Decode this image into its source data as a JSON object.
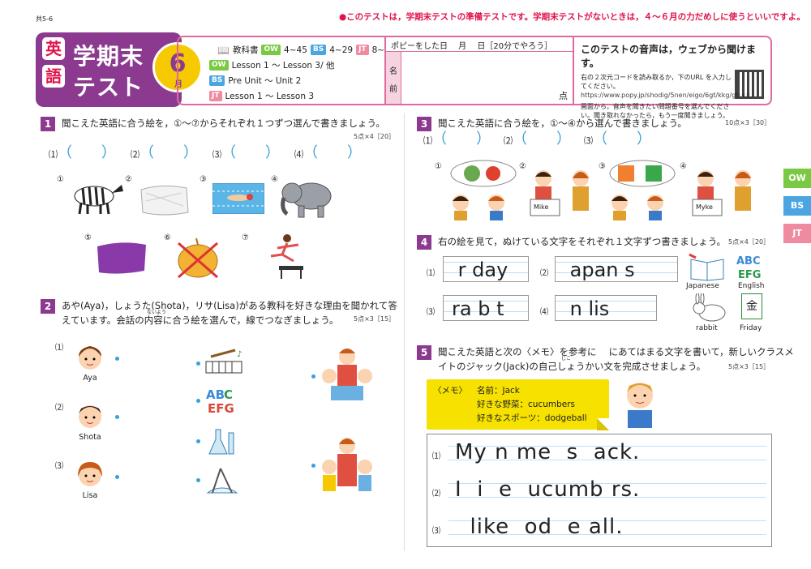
{
  "meta": {
    "code": "共5-6"
  },
  "notice": "●このテストは，学期末テストの準備テストです。学期末テストがないときは，４～６月の力だめしに使うといいですよ。",
  "header": {
    "subject_1": "英",
    "subject_2": "語",
    "title_1": "学期末",
    "title_2": "テスト",
    "month_num": "6",
    "month_label": "月",
    "textbook_label": "教科書",
    "ow_tag": "OW",
    "ow_pages": "4~45",
    "bs_tag": "BS",
    "bs_pages": "4~29",
    "jt_tag": "JT",
    "jt_pages": "8~54",
    "rows": [
      {
        "tag": "OW",
        "text": "Lesson 1 ～ Lesson 3/ 他"
      },
      {
        "tag": "BS",
        "text": "Pre Unit ～ Unit 2"
      },
      {
        "tag": "JT",
        "text": "Lesson 1 ～ Lesson 3"
      }
    ],
    "name_top": "ポピーをした日　 月　 日［20分でやろう］",
    "name_label": "名前",
    "points_label": "点",
    "audio_title": "このテストの音声は，ウェブから聞けます。",
    "audio_text_1": "右の２次元コードを読み取るか，下のURL を入力してください。",
    "audio_url": "https://www.popy.jp/shodig/5nen/eigo/6gt/kkg/gtest/",
    "audio_text_2": "画面から，音声を聞きたい問題番号を選んでください。聞き取れなかったら，もう一度聞きましょう。"
  },
  "side_tabs": [
    "OW",
    "BS",
    "JT"
  ],
  "q1": {
    "num": "1",
    "text": "聞こえた英語に合う絵を，①～⑦からそれぞれ１つずつ選んで書きましょう。",
    "points": "5点×4［20］",
    "blanks": [
      "⑴",
      "⑵",
      "⑶",
      "⑷"
    ],
    "choices": [
      "①",
      "②",
      "③",
      "④",
      "⑤",
      "⑥",
      "⑦"
    ]
  },
  "q2": {
    "num": "2",
    "text_1": "あや(Aya)，しょうた(Shota)，リサ(Lisa)がある教科を好きな理由を聞かれて答",
    "text_2": "えています。会話の内容に合う絵を選んで，線でつなぎましょう。",
    "ruby": "ないよう",
    "points": "5点×3［15］",
    "people": [
      {
        "num": "⑴",
        "name": "Aya"
      },
      {
        "num": "⑵",
        "name": "Shota"
      },
      {
        "num": "⑶",
        "name": "Lisa"
      }
    ]
  },
  "q3": {
    "num": "3",
    "text": "聞こえた英語に合う絵を，①～④から選んで書きましょう。",
    "points": "10点×3［30］",
    "blanks": [
      "⑴",
      "⑵",
      "⑶"
    ],
    "choices": [
      "①",
      "②",
      "③",
      "④"
    ],
    "cards": [
      "Mike",
      "Myke"
    ]
  },
  "q4": {
    "num": "4",
    "text": "右の絵を見て，ぬけている文字をそれぞれ１文字ずつ書きましょう。",
    "points": "5点×4［20］",
    "items": [
      {
        "num": "⑴",
        "word": " r day"
      },
      {
        "num": "⑵",
        "word": " apan s"
      },
      {
        "num": "⑶",
        "word": "ra b t"
      },
      {
        "num": "⑷",
        "word": " n lis "
      }
    ],
    "pictures": [
      "Japanese",
      "English",
      "rabbit",
      "Friday"
    ],
    "kanji": "金"
  },
  "q5": {
    "num": "5",
    "text_1": "聞こえた英語と次の〈メモ〉を参考に　 にあてはまる文字を書いて，新しいクラスメ",
    "text_2": "イトのジャック(Jack)の自己しょうかい文を完成させましょう。",
    "ruby": "じこ",
    "points": "5点×3［15］",
    "memo_label": "〈メモ〉",
    "memo": [
      "名前：Jack",
      "好きな野菜：cucumbers",
      "好きなスポーツ：dodgeball"
    ],
    "lines": [
      {
        "num": "⑴",
        "text": "My n me  s  ack."
      },
      {
        "num": "⑵",
        "text": "I  i  e  ucumb rs."
      },
      {
        "num": "⑶",
        "text": "  like  od  e all."
      }
    ]
  },
  "colors": {
    "purple": "#8b3a8f",
    "pink": "#e06aa0",
    "red": "#e0144c",
    "blue": "#3aa0d8",
    "yellow": "#f6e100"
  }
}
